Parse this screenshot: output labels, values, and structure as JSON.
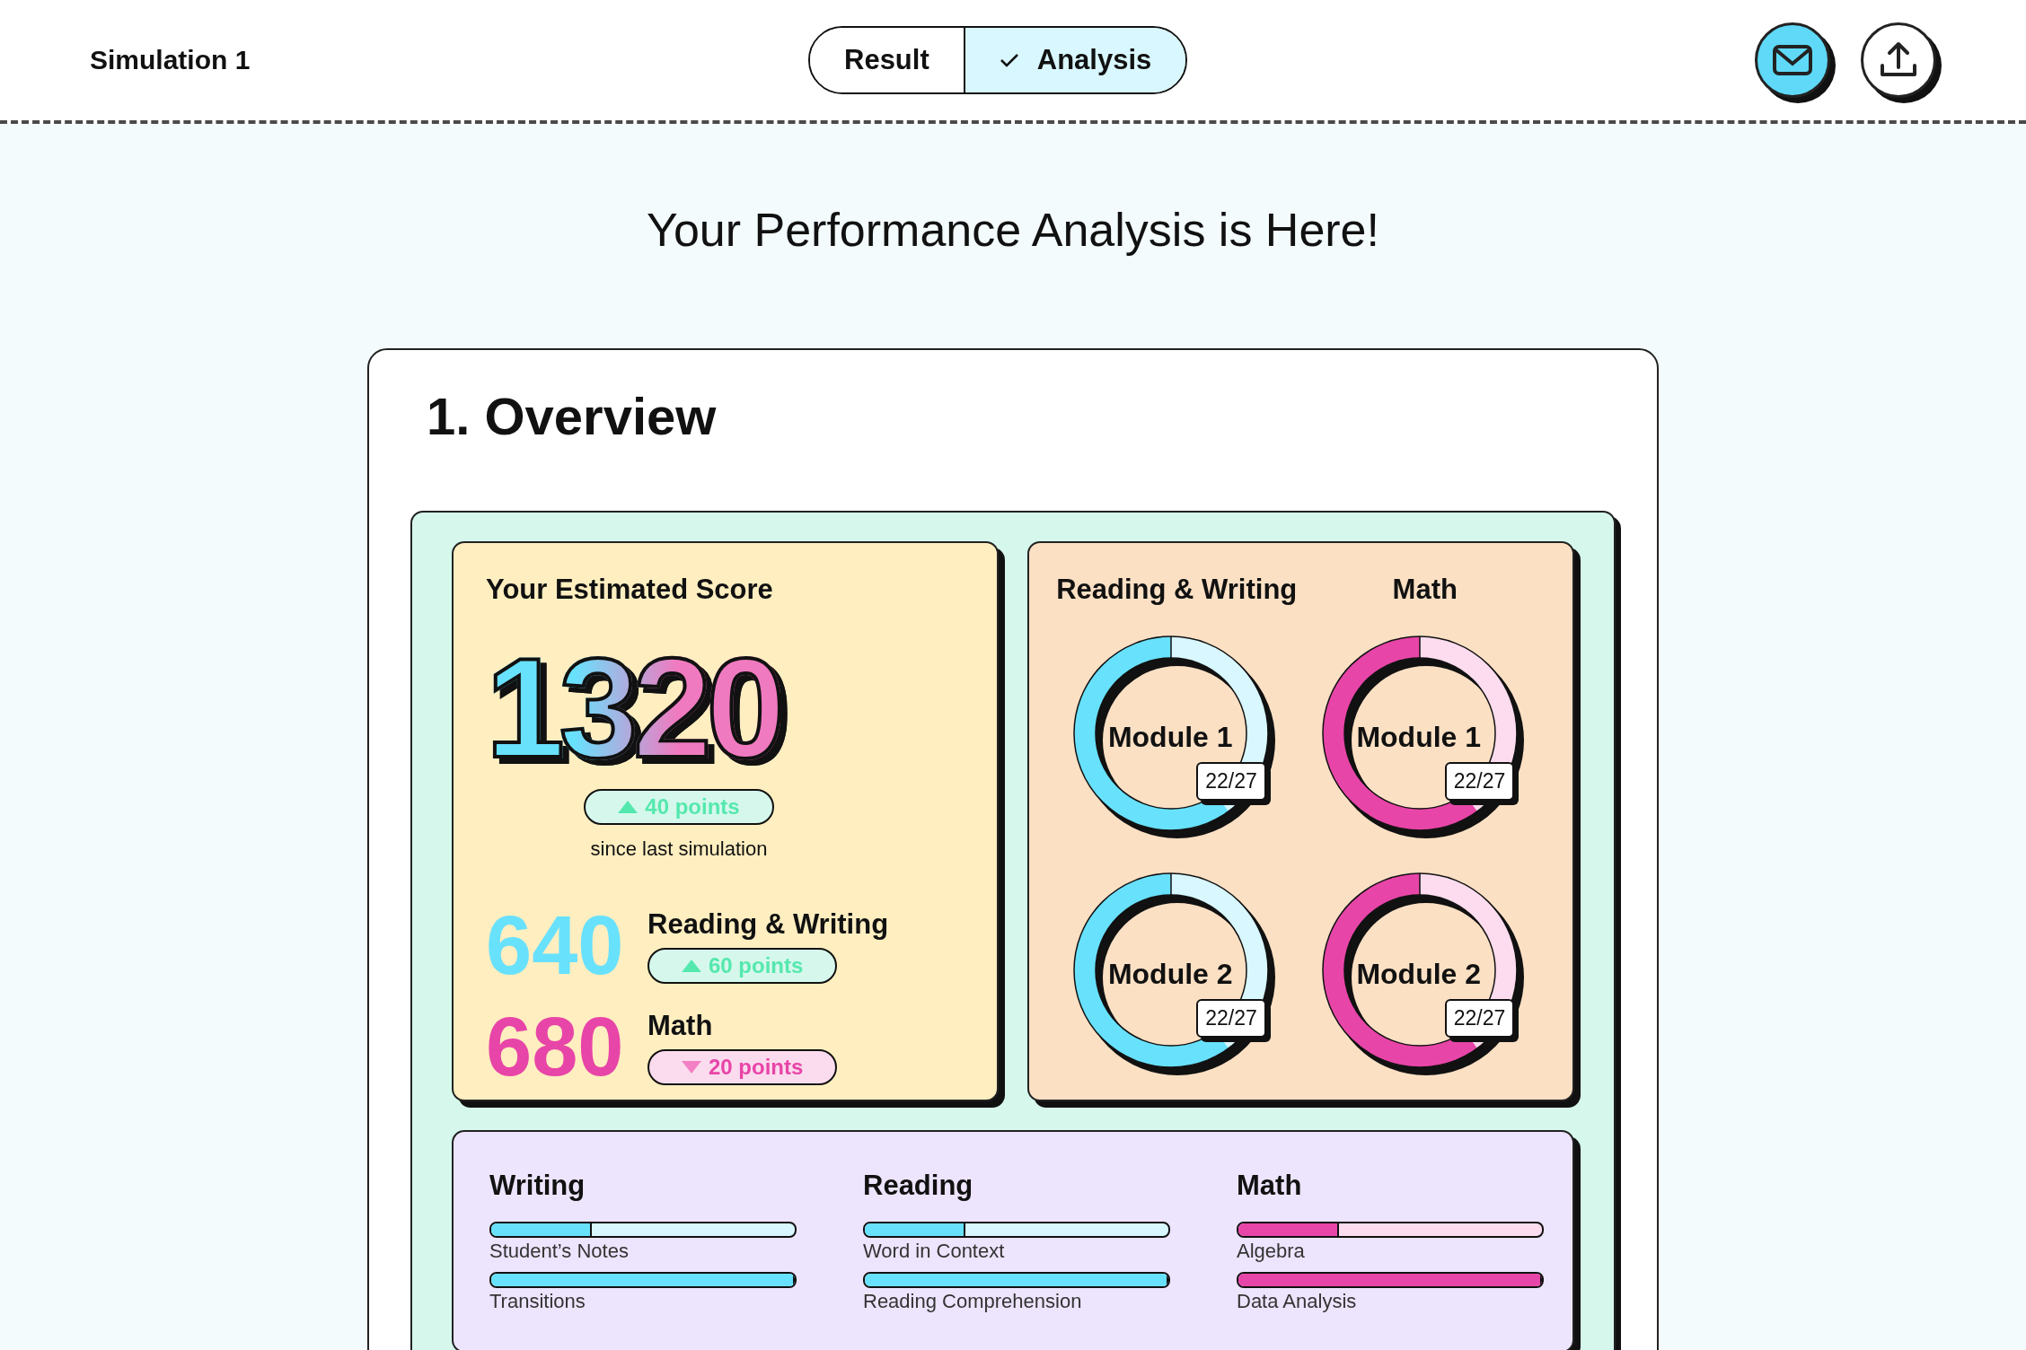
{
  "header": {
    "title": "Simulation 1",
    "tabs": [
      {
        "label": "Result",
        "selected": false
      },
      {
        "label": "Analysis",
        "selected": true
      }
    ]
  },
  "page_title": "Your Performance Analysis is Here!",
  "overview": {
    "heading": "1. Overview",
    "estimated_score": {
      "label": "Your Estimated Score",
      "total": "1320",
      "change": {
        "text": "40 points",
        "kind": "up"
      },
      "caption": "since last simulation",
      "sections": [
        {
          "score": "640",
          "name": "Reading & Writing",
          "color": "#68e1fd",
          "change": {
            "text": "60 points",
            "kind": "up"
          }
        },
        {
          "score": "680",
          "name": "Math",
          "color": "#e845a8",
          "change": {
            "text": "20 points",
            "kind": "down"
          }
        }
      ]
    },
    "modules": [
      {
        "subject": "Reading & Writing",
        "color": "#68e1fd",
        "items": [
          {
            "name": "Module 1",
            "score": "22/27",
            "level": 0.6
          },
          {
            "name": "Module 2",
            "score": "22/27",
            "level": 0.6
          }
        ]
      },
      {
        "subject": "Math",
        "color": "#e845a8",
        "items": [
          {
            "name": "Module 1",
            "score": "22/27",
            "level": 0.6
          },
          {
            "name": "Module 2",
            "score": "22/27",
            "level": 0.6
          }
        ]
      }
    ],
    "skills": [
      {
        "subject": "Writing",
        "color": "#68e1fd",
        "items": [
          {
            "name": "Student’s Notes",
            "level": 0.33
          },
          {
            "name": "Transitions",
            "level": 1
          }
        ]
      },
      {
        "subject": "Reading",
        "color": "#68e1fd",
        "items": [
          {
            "name": "Word in Context",
            "level": 0.33
          },
          {
            "name": "Reading Comprehension",
            "level": 1
          }
        ]
      },
      {
        "subject": "Math",
        "color": "#e845a8",
        "items": [
          {
            "name": "Algebra",
            "level": 0.33
          },
          {
            "name": "Data Analysis",
            "level": 1
          }
        ]
      }
    ]
  }
}
